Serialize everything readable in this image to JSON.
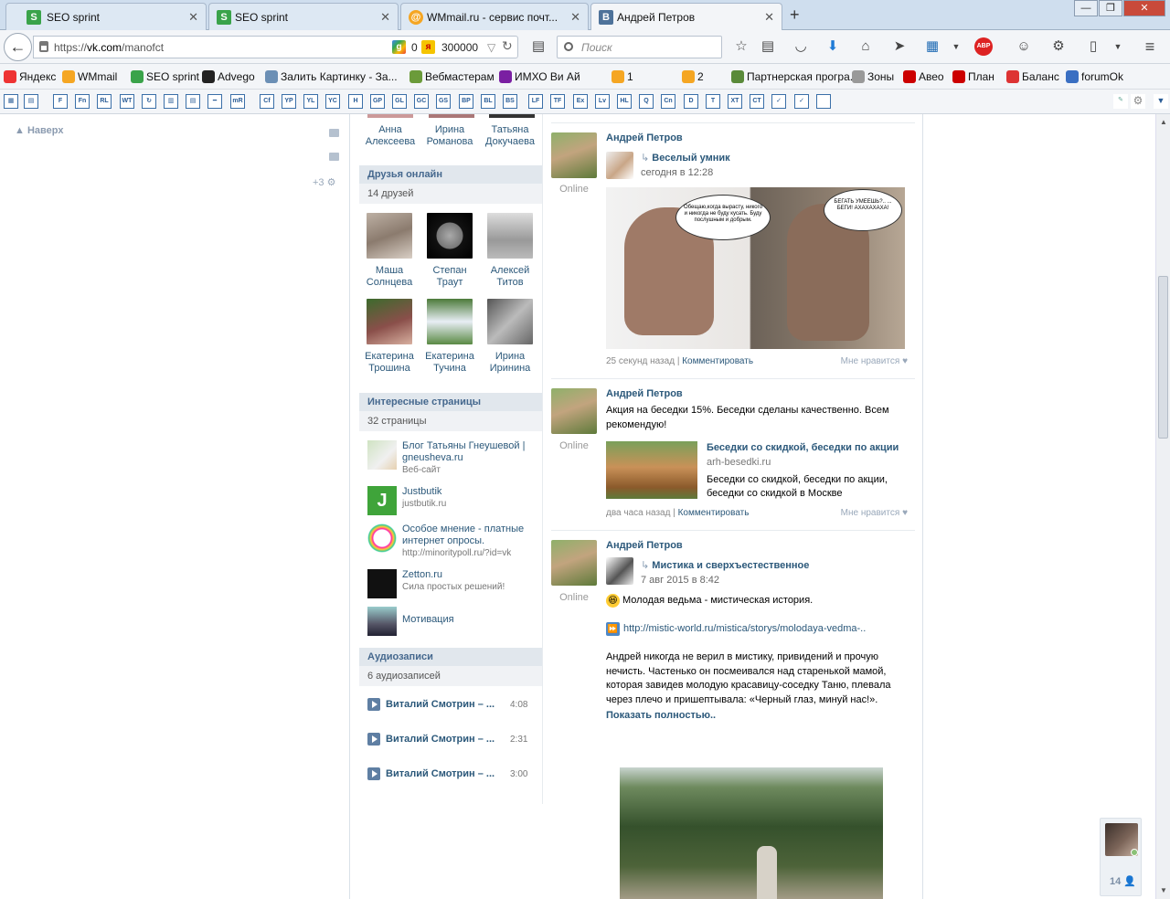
{
  "browser": {
    "tabs": [
      {
        "title": "SEO sprint",
        "icon": "seo-sprint-icon"
      },
      {
        "title": "SEO sprint",
        "icon": "seo-sprint-icon"
      },
      {
        "title": "WMmail.ru - сервис почт...",
        "icon": "wmmail-icon"
      },
      {
        "title": "Андрей Петров",
        "icon": "vk-icon"
      }
    ],
    "url_prefix": "https://",
    "url_domain": "vk.com",
    "url_path": "/manofct",
    "seo_value_1": "0",
    "seo_value_2": "300000",
    "search_placeholder": "Поиск",
    "bookmarks": [
      {
        "label": "Яндекс",
        "icon": "yandex-icon",
        "color": "#e33"
      },
      {
        "label": "WMmail",
        "icon": "wmmail-icon",
        "color": "#f5a623"
      },
      {
        "label": "SEO sprint",
        "icon": "seo-sprint-icon",
        "color": "#3aa34a"
      },
      {
        "label": "Advego",
        "icon": "advego-icon",
        "color": "#222"
      },
      {
        "label": "Залить Картинку - За...",
        "icon": "image-host-icon",
        "color": "#6b8fb5"
      },
      {
        "label": "Вебмастерам",
        "icon": "webmaster-icon",
        "color": "#6b9b3a"
      },
      {
        "label": "ИМХО Ви Ай",
        "icon": "imho-icon",
        "color": "#7a1fa2"
      },
      {
        "label": "1",
        "icon": "counter-icon",
        "color": "#f5a623"
      },
      {
        "label": "2",
        "icon": "counter-icon",
        "color": "#f5a623"
      },
      {
        "label": "Партнерская програ...",
        "icon": "partner-icon",
        "color": "#5a8a3a"
      },
      {
        "label": "Зоны",
        "icon": "zones-icon",
        "color": "#999"
      },
      {
        "label": "Авео",
        "icon": "aveo-icon",
        "color": "#c00"
      },
      {
        "label": "План",
        "icon": "plan-icon",
        "color": "#c00"
      },
      {
        "label": "Баланс",
        "icon": "balance-icon",
        "color": "#d33"
      },
      {
        "label": "forumOk",
        "icon": "forum-icon",
        "color": "#3a6fc2"
      }
    ],
    "addon_buttons": [
      "F",
      "Fn",
      "RL",
      "WT",
      "↻",
      "▥",
      "▤",
      "━",
      "mR",
      "Cf",
      "YP",
      "YL",
      "YC",
      "H",
      "GP",
      "GL",
      "GC",
      "GS",
      "BP",
      "BL",
      "BS",
      "LF",
      "TF",
      "Ex",
      "Lv",
      "HL",
      "Q",
      "Cn",
      "D",
      "T",
      "XT",
      "CT",
      "✓",
      "✓",
      ""
    ]
  },
  "page": {
    "up_label": "Наверх",
    "side_counter": "+3",
    "members_top": [
      "Анна Алексеева",
      "Ирина Романова",
      "Татьяна Докучаева"
    ],
    "friends_online": {
      "header": "Друзья онлайн",
      "count": "14 друзей",
      "items": [
        {
          "name": "Маша Солнцева"
        },
        {
          "name": "Степан Траут"
        },
        {
          "name": "Алексей Титов"
        },
        {
          "name": "Екатерина Трошина"
        },
        {
          "name": "Екатерина Тучина"
        },
        {
          "name": "Ирина Иринина"
        }
      ]
    },
    "pages": {
      "header": "Интересные страницы",
      "count": "32 страницы",
      "items": [
        {
          "title": "Блог Татьяны Гнеушевой | gneusheva.ru",
          "sub": "Веб-сайт"
        },
        {
          "title": "Justbutik",
          "sub": "justbutik.ru"
        },
        {
          "title": "Особое мнение - платные интернет опросы.",
          "sub": "http://minoritypoll.ru/?id=vk"
        },
        {
          "title": "Zetton.ru",
          "sub": "Сила простых решений!"
        },
        {
          "title": "Мотивация",
          "sub": ""
        }
      ]
    },
    "audio": {
      "header": "Аудиозаписи",
      "count": "6 аудиозаписей",
      "items": [
        {
          "title": "Виталий Смотрин – ...",
          "duration": "4:08"
        },
        {
          "title": "Виталий Смотрин – ...",
          "duration": "2:31"
        },
        {
          "title": "Виталий Смотрин – ...",
          "duration": "3:00"
        }
      ]
    },
    "posts": [
      {
        "author": "Андрей Петров",
        "status": "Online",
        "repost_title": "Веселый умник",
        "date": "сегодня в 12:28",
        "bubble_left": "Обещаю,когда вырасту, никого и никогда не буду кусать. Буду послушным и добрым.",
        "bubble_right": "БЕГАТЬ УМЕЕШЬ?.. ... БЕГИ! АХАХАХАХА!",
        "time": "25 секунд назад",
        "comment": "Комментировать",
        "like": "Мне нравится"
      },
      {
        "author": "Андрей Петров",
        "status": "Online",
        "text": "Акция на беседки 15%. Беседки сделаны качественно. Всем рекомендую!",
        "link_title": "Беседки со скидкой, беседки по акции",
        "link_domain": "arh-besedki.ru",
        "link_desc": "Беседки со скидкой, беседки по акции, беседки со скидкой в Москве",
        "time": "два часа назад",
        "comment": "Комментировать",
        "like": "Мне нравится"
      },
      {
        "author": "Андрей Петров",
        "status": "Online",
        "repost_title": "Мистика и сверхъестественное",
        "date": "7 авг 2015 в 8:42",
        "line1": "Молодая ведьма - мистическая история.",
        "link": "http://mistic-world.ru/mistica/storys/molodaya-vedma-..",
        "body": "Андрей никогда не верил в мистику, привидений и прочую нечисть. Частенько он посмеивался над старенькой мамой, которая завидев молодую красавицу-соседку Таню, плевала через плечо и пришептывала: «Черный глаз, минуй нас!».",
        "more": "Показать полностью.."
      }
    ],
    "chat_count": "14"
  }
}
